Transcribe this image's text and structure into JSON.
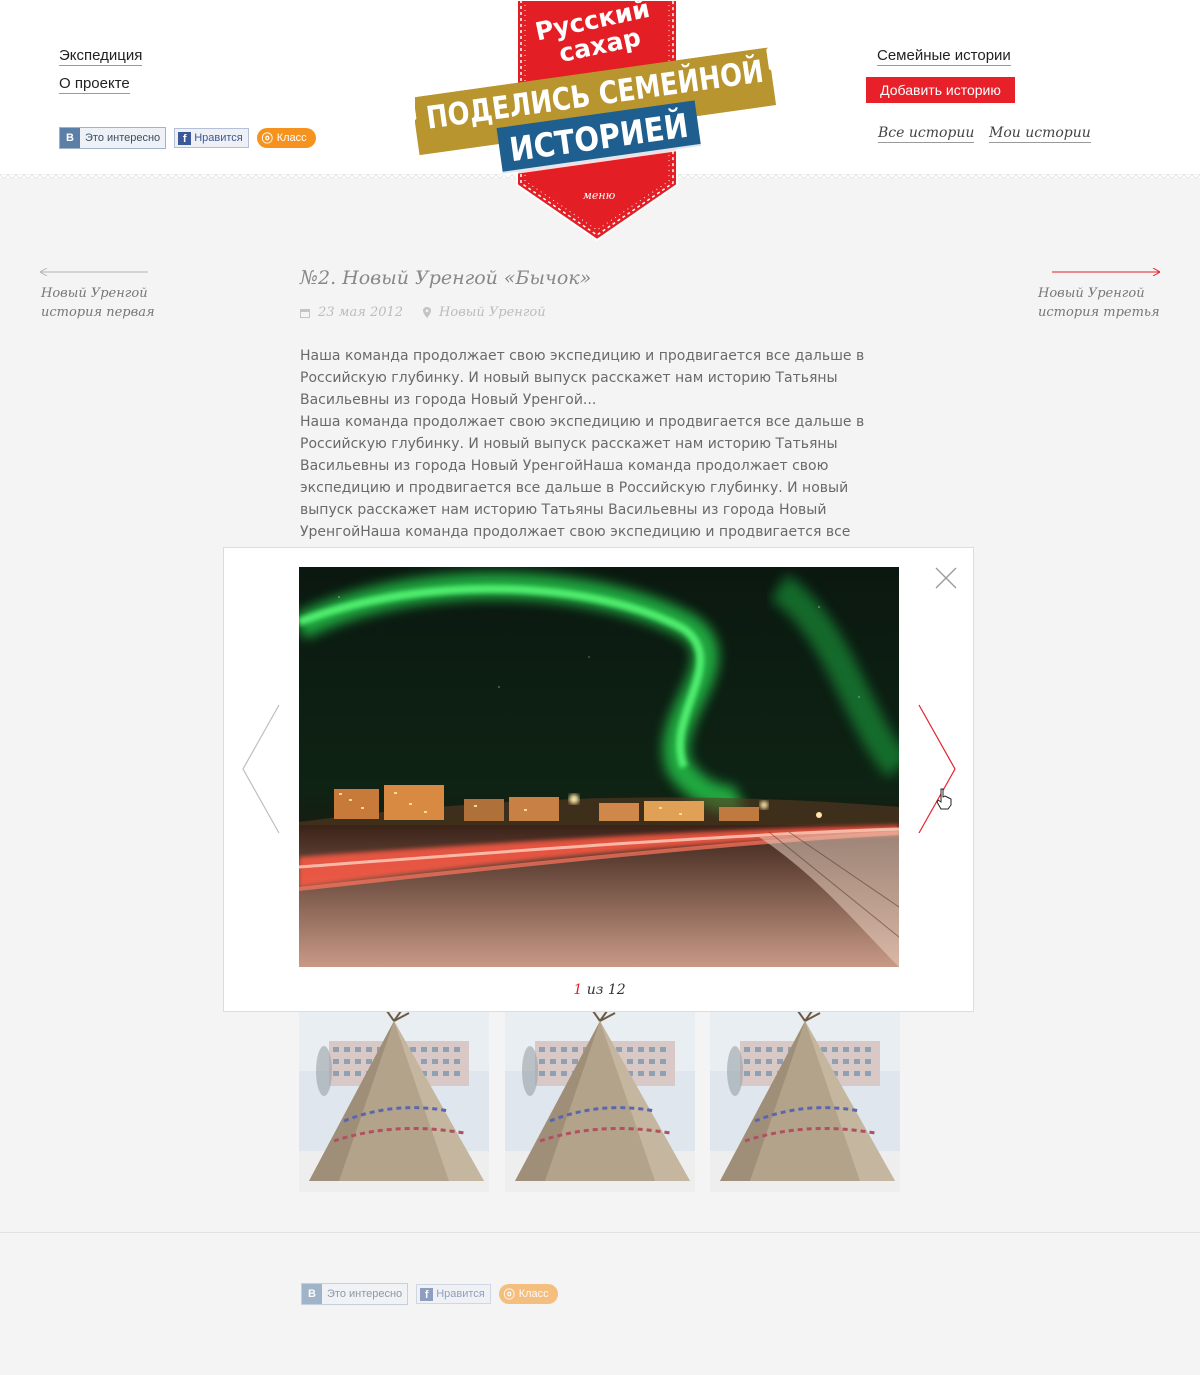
{
  "header": {
    "left_nav": [
      "Экспедиция",
      "О проекте"
    ],
    "right_nav": {
      "family_stories": "Семейные истории",
      "add_story": "Добавить историю",
      "all_stories": "Все истории",
      "my_stories": "Мои истории"
    },
    "share": {
      "vk": "Это интересно",
      "vk_letter": "B",
      "fb": "Нравится",
      "fb_letter": "f",
      "ok": "Класс",
      "ok_letter": "ok"
    }
  },
  "logo": {
    "brand_line1": "Русский",
    "brand_line2": "сахар",
    "slogan_line1": "ПОДЕЛИСЬ СЕМЕЙНОЙ",
    "slogan_line2": "ИСТОРИЕЙ",
    "menu": "меню"
  },
  "prev_story": {
    "line1": "Новый Уренгой",
    "line2": "история первая"
  },
  "next_story": {
    "line1": "Новый Уренгой",
    "line2": "история третья"
  },
  "story": {
    "title": "№2. Новый Уренгой «Бычок»",
    "date": "23 мая 2012",
    "location": "Новый Уренгой",
    "paragraphs": [
      "Наша команда продолжает свою экспедицию и продвигается все дальше в Российскую глубинку. И новый выпуск расскажет нам историю Татьяны Васильевны из города Новый Уренгой...",
      "Наша команда продолжает свою экспедицию и продвигается все дальше в Российскую глубинку. И новый выпуск расскажет нам историю Татьяны Васильевны из города Новый УренгойНаша команда продолжает свою экспедицию и продвигается все дальше в Российскую глубинку. И новый выпуск расскажет нам историю Татьяны Васильевны из города Новый УренгойНаша команда продолжает свою экспедицию и продвигается все дальше в Российскую глубинку. И новый выпуск расскажет нам"
    ]
  },
  "lightbox": {
    "current": "1",
    "separator": "из",
    "total": "12"
  },
  "colors": {
    "accent": "#e8202a",
    "gold": "#b8952e",
    "blue": "#1f5f8f",
    "page_bg": "#f4f4f4"
  },
  "icons": [
    "calendar-icon",
    "location-pin-icon",
    "close-icon",
    "arrow-left-icon",
    "arrow-right-icon",
    "hand-cursor-icon"
  ]
}
